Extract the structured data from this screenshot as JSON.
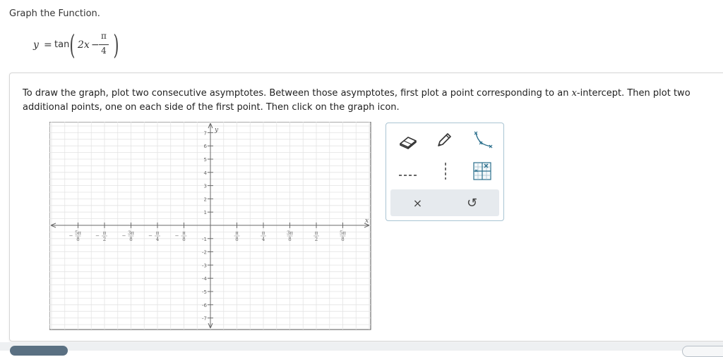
{
  "header": {
    "title": "Graph the Function."
  },
  "equation": {
    "lhs": "y",
    "eq": "=",
    "fn": "tan",
    "arg": "2x",
    "minus": "−",
    "num": "π",
    "den": "4"
  },
  "instructions": {
    "before_var": "To draw the graph, plot two consecutive asymptotes. Between those asymptotes, first plot a point corresponding to an ",
    "var": "x",
    "after_var": "-intercept. Then plot two additional points, one on each side of the first point. Then click on the graph icon."
  },
  "graph": {
    "x_axis_label": "x",
    "y_axis_label": "y",
    "x_ticks": [
      {
        "num": "5π",
        "den": "8",
        "sign": "−"
      },
      {
        "num": "π",
        "den": "2",
        "sign": "−"
      },
      {
        "num": "3π",
        "den": "8",
        "sign": "−"
      },
      {
        "num": "π",
        "den": "4",
        "sign": "−"
      },
      {
        "num": "π",
        "den": "8",
        "sign": "−"
      },
      {
        "num": "π",
        "den": "8",
        "sign": ""
      },
      {
        "num": "π",
        "den": "4",
        "sign": ""
      },
      {
        "num": "3π",
        "den": "8",
        "sign": ""
      },
      {
        "num": "π",
        "den": "2",
        "sign": ""
      },
      {
        "num": "5π",
        "den": "8",
        "sign": ""
      }
    ],
    "y_ticks": [
      "7",
      "6",
      "5",
      "4",
      "3",
      "2",
      "1",
      "-1",
      "-2",
      "-3",
      "-4",
      "-5",
      "-6",
      "-7"
    ]
  },
  "toolbox": {
    "tools": [
      {
        "name": "eraser-tool",
        "icon": "eraser-icon"
      },
      {
        "name": "pencil-tool",
        "icon": "pencil-icon"
      },
      {
        "name": "tangent-curve-tool",
        "icon": "tangent-curve-icon"
      },
      {
        "name": "horizontal-asymptote-tool",
        "icon": "dashed-horizontal-line-icon"
      },
      {
        "name": "vertical-asymptote-tool",
        "icon": "dashed-vertical-line-icon"
      },
      {
        "name": "graph-tool",
        "icon": "graph-grid-icon"
      }
    ],
    "actions": {
      "clear": "×",
      "undo": "↺"
    }
  },
  "colors": {
    "toolbox_border": "#a9c4d3",
    "icon_blue": "#2b6f8c",
    "grid": "#e2e2e2",
    "axis": "#6a6a6a"
  }
}
